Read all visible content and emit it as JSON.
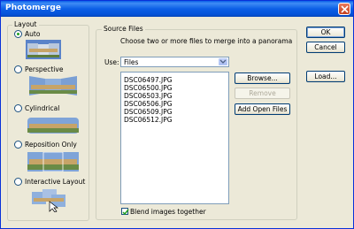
{
  "window": {
    "title": "Photomerge"
  },
  "layout": {
    "legend": "Layout",
    "options": [
      {
        "label": "Auto",
        "selected": true
      },
      {
        "label": "Perspective",
        "selected": false
      },
      {
        "label": "Cylindrical",
        "selected": false
      },
      {
        "label": "Reposition Only",
        "selected": false
      },
      {
        "label": "Interactive Layout",
        "selected": false
      }
    ]
  },
  "source": {
    "legend": "Source Files",
    "instructions": "Choose two or more files to merge into a panorama",
    "use_label": "Use:",
    "use_value": "Files",
    "files": [
      "DSC06497.JPG",
      "DSC06500.JPG",
      "DSC06503.JPG",
      "DSC06506.JPG",
      "DSC06509.JPG",
      "DSC06512.JPG"
    ],
    "browse_label": "Browse...",
    "remove_label": "Remove",
    "add_open_label": "Add Open Files",
    "blend_label": "Blend images together",
    "blend_checked": true
  },
  "actions": {
    "ok_label": "OK",
    "cancel_label": "Cancel",
    "load_label": "Load..."
  }
}
